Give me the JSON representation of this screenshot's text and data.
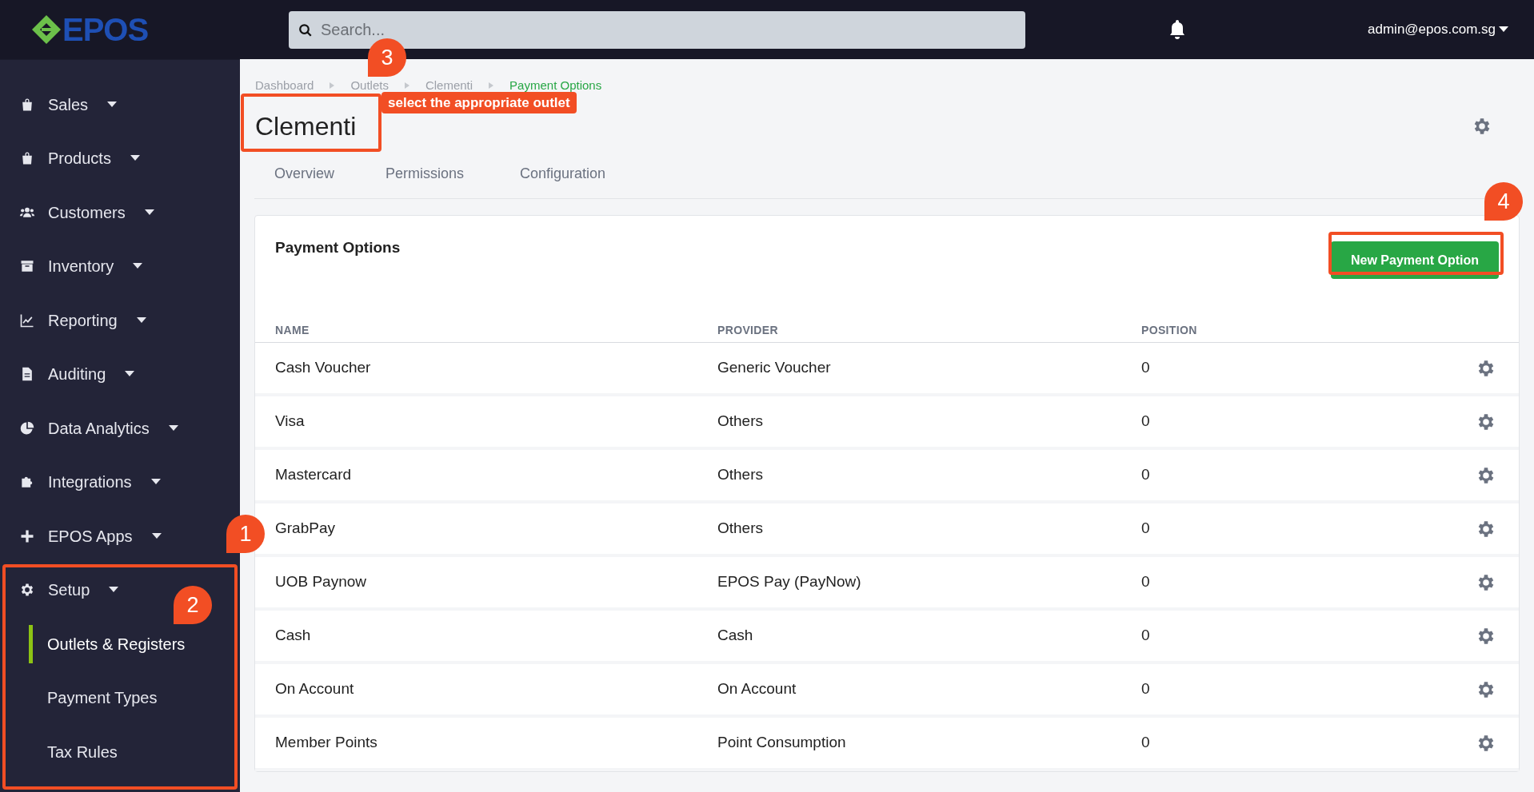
{
  "header": {
    "logo": "EPOS",
    "search": {
      "placeholder": "Search..."
    },
    "user": "admin@epos.com.sg"
  },
  "sidebar": {
    "items": [
      {
        "label": "Sales"
      },
      {
        "label": "Products"
      },
      {
        "label": "Customers"
      },
      {
        "label": "Inventory"
      },
      {
        "label": "Reporting"
      },
      {
        "label": "Auditing"
      },
      {
        "label": "Data Analytics"
      },
      {
        "label": "Integrations"
      },
      {
        "label": "EPOS Apps"
      },
      {
        "label": "Setup",
        "children": [
          {
            "label": "Outlets & Registers",
            "selected": true
          },
          {
            "label": "Payment Types",
            "selected": false
          },
          {
            "label": "Tax Rules",
            "selected": false
          }
        ]
      }
    ]
  },
  "breadcrumb": [
    {
      "label": "Dashboard",
      "current": false
    },
    {
      "label": "Outlets",
      "current": false
    },
    {
      "label": "Clementi",
      "current": false
    },
    {
      "label": "Payment Options",
      "current": true
    }
  ],
  "page_title": "Clementi",
  "tabs": [
    {
      "label": "Overview",
      "selected": false
    },
    {
      "label": "Permissions",
      "selected": false
    },
    {
      "label": "Configuration",
      "selected": false
    }
  ],
  "card": {
    "title": "Payment Options",
    "button": "New Payment Option",
    "table": {
      "columns": [
        "NAME",
        "PROVIDER",
        "POSITION"
      ],
      "rows": [
        [
          "Cash Voucher",
          "Generic Voucher",
          "0"
        ],
        [
          "Visa",
          "Others",
          "0"
        ],
        [
          "Mastercard",
          "Others",
          "0"
        ],
        [
          "GrabPay",
          "Others",
          "0"
        ],
        [
          "UOB Paynow",
          "EPOS Pay (PayNow)",
          "0"
        ],
        [
          "Cash",
          "Cash",
          "0"
        ],
        [
          "On Account",
          "On Account",
          "0"
        ],
        [
          "Member Points",
          "Point Consumption",
          "0"
        ]
      ]
    }
  },
  "annotations": [
    {
      "number": "1"
    },
    {
      "number": "2"
    },
    {
      "number": "3",
      "note": "select the appropriate outlet"
    },
    {
      "number": "4"
    }
  ]
}
